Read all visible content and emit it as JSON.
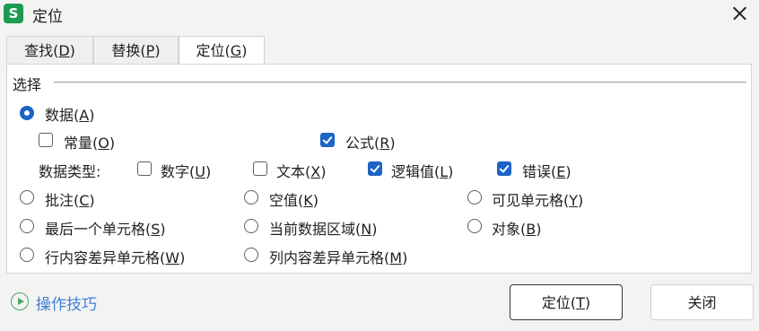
{
  "window": {
    "app_icon": "S",
    "title": "定位"
  },
  "tabs": [
    {
      "name": "查找(",
      "key": "D",
      "tail": ")"
    },
    {
      "name": "替换(",
      "key": "P",
      "tail": ")"
    },
    {
      "name": "定位(",
      "key": "G",
      "tail": ")"
    }
  ],
  "group_label": "选择",
  "options": {
    "data": {
      "pre": "数据(",
      "key": "A",
      "tail": ")",
      "checked": true
    },
    "constant": {
      "pre": "常量(",
      "key": "O",
      "tail": ")",
      "checked": false
    },
    "formula": {
      "pre": "公式(",
      "key": "R",
      "tail": ")",
      "checked": true
    },
    "data_type_label": "数据类型:",
    "number": {
      "pre": "数字(",
      "key": "U",
      "tail": ")",
      "checked": false
    },
    "text": {
      "pre": "文本(",
      "key": "X",
      "tail": ")",
      "checked": false
    },
    "logical": {
      "pre": "逻辑值(",
      "key": "L",
      "tail": ")",
      "checked": true
    },
    "error": {
      "pre": "错误(",
      "key": "E",
      "tail": ")",
      "checked": true
    },
    "comment": {
      "pre": "批注(",
      "key": "C",
      "tail": ")"
    },
    "blank": {
      "pre": "空值(",
      "key": "K",
      "tail": ")"
    },
    "visible": {
      "pre": "可见单元格(",
      "key": "Y",
      "tail": ")"
    },
    "last_cell": {
      "pre": "最后一个单元格(",
      "key": "S",
      "tail": ")"
    },
    "current_region": {
      "pre": "当前数据区域(",
      "key": "N",
      "tail": ")"
    },
    "objects": {
      "pre": "对象(",
      "key": "B",
      "tail": ")"
    },
    "row_diff": {
      "pre": "行内容差异单元格(",
      "key": "W",
      "tail": ")"
    },
    "col_diff": {
      "pre": "列内容差异单元格(",
      "key": "M",
      "tail": ")"
    }
  },
  "footer": {
    "tips": "操作技巧",
    "locate_button": {
      "pre": "定位(",
      "key": "T",
      "tail": ")"
    },
    "close_button": "关闭"
  },
  "colors": {
    "accent": "#1b63c6",
    "app_icon_bg": "#1d9b51",
    "link": "#3f7fd6"
  }
}
